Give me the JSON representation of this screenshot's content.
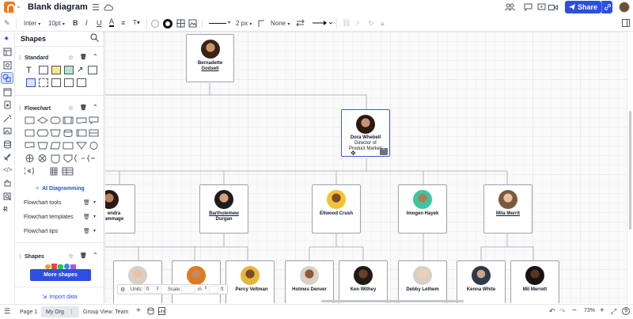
{
  "titlebar": {
    "title": "Blank diagram",
    "share_label": "Share"
  },
  "toolbar": {
    "font": "Inter",
    "font_size": "10pt",
    "line_width": "2 px",
    "endpoint": "None"
  },
  "panel": {
    "title": "Shapes",
    "standard_label": "Standard",
    "flowchart_label": "Flowchart",
    "ai_label": "AI Diagramming",
    "tools": [
      {
        "label": "Flowchart tools"
      },
      {
        "label": "Flowchart templates"
      },
      {
        "label": "Flowchart tips"
      }
    ],
    "shapes_label": "Shapes",
    "more_shapes": "More shapes",
    "import_label": "Import data"
  },
  "canvas": {
    "units_label": "Units:",
    "units_value": "ft",
    "scale_label": "Scale:",
    "scale_value": "in",
    "scale_unit": "ft",
    "top": {
      "name1": "Bernadette",
      "name2": "Godsell"
    },
    "director": {
      "name": "Dora Whebell",
      "title1": "Director of",
      "title2": "Product Marketi"
    },
    "level2": [
      {
        "name1": "endra",
        "name2": "ammage"
      },
      {
        "name1": "Bartholemew",
        "name2": "Durgan"
      },
      {
        "name1": "Ellwood Crush",
        "name2": ""
      },
      {
        "name1": "Imogen Hayek",
        "name2": ""
      },
      {
        "name1": "Mila Merrit",
        "name2": ""
      }
    ],
    "level3": [
      {
        "name": ""
      },
      {
        "name": ""
      },
      {
        "name": "Percy Veltman"
      },
      {
        "name": "Holmes Denver"
      },
      {
        "name": "Ken Withey"
      },
      {
        "name": "Debby Lethem"
      },
      {
        "name": "Kenna White"
      },
      {
        "name": "Mil Merrett"
      }
    ]
  },
  "bottombar": {
    "page1": "Page 1",
    "page2": "My Org",
    "page3": "Group View: Team",
    "zoom": "73%"
  }
}
